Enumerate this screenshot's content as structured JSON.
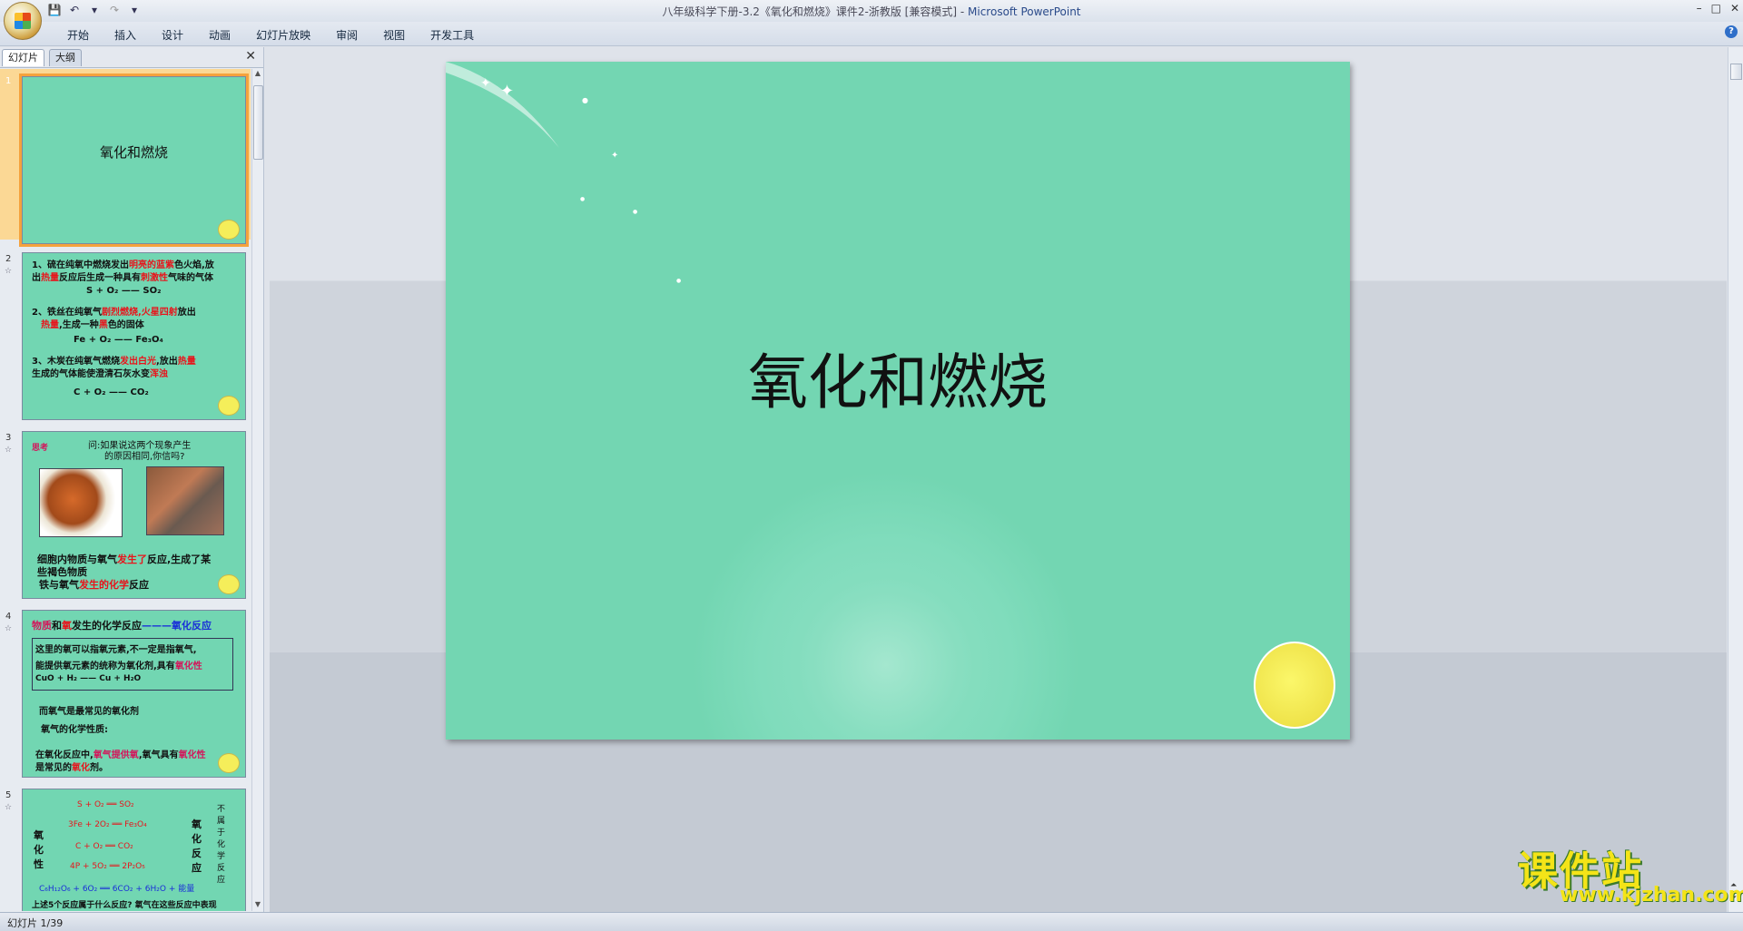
{
  "window": {
    "title_doc": "八年级科学下册-3.2《氧化和燃烧》课件2-浙教版 [兼容模式] - ",
    "title_app": "Microsoft PowerPoint",
    "min": "–",
    "max": "□",
    "close": "✕"
  },
  "ribbon": {
    "tabs": [
      "开始",
      "插入",
      "设计",
      "动画",
      "幻灯片放映",
      "审阅",
      "视图",
      "开发工具"
    ],
    "help": "?"
  },
  "pane": {
    "tab_slides": "幻灯片",
    "tab_outline": "大纲",
    "close": "✕"
  },
  "thumbs": {
    "s1": {
      "num": "1",
      "title": "氧化和燃烧"
    },
    "s2": {
      "num": "2",
      "l1": "1、硫在纯氧中燃烧发出",
      "l1r": "明亮的蓝紫",
      "l1b": "色火焰,放",
      "l2": "出",
      "l2r": "热量",
      "l2b": "反应后生成一种具有",
      "l2r2": "刺激性",
      "l2c": "气味的气体",
      "l3": "S  +  O₂   ——  SO₂",
      "l4": "2、铁丝在纯氧气",
      "l4r": "剧烈燃烧,火星四射",
      "l4b": "放出",
      "l5r": "热量",
      "l5": ",生成一种",
      "l5r2": "黑",
      "l5b": "色的固体",
      "l6": "Fe  +  O₂   ——  Fe₃O₄",
      "l7": "3、木炭在纯氧气燃烧",
      "l7r": "发出白光",
      "l7b": ",放出",
      "l7r2": "热量",
      "l8": "生成的气体能使澄清石灰水变",
      "l8r": "浑浊",
      "l9": "C  +  O₂   ——  CO₂"
    },
    "s3": {
      "num": "3",
      "tag": "思考",
      "q1": "问:如果说这两个现象产生",
      "q2": "的原因相同,你信吗?",
      "l1": "细胞内物质与氧气",
      "l1r": "发生了",
      "l1b": "反应,生成了某",
      "l2": "些褐色物质",
      "l3": "铁与氧气",
      "l3r": "发生的化学",
      "l3b": "反应"
    },
    "s4": {
      "num": "4",
      "h1": "物质",
      "h2": "和",
      "h3": "氧",
      "h4": "发生的化学反应",
      "h5": "———氧化反应",
      "b1": "这里的氧可以指氧元素,不一定是指氧气,",
      "b2": "能提供氧元素的统称为氧化剂,具有",
      "b2m": "氧化性",
      "b3": "CuO  +  H₂      ——      Cu  +  H₂O",
      "l1": "而氧气是最常见的氧化剂",
      "l2": "氧气的化学性质:",
      "l3": "在氧化反应中,",
      "l3m": "氧气提供氧",
      "l3b": ",氧气具有",
      "l3m2": "氧化性",
      "l4": "是常见的",
      "l4r": "氧化",
      "l4b": "剂。"
    },
    "s5": {
      "num": "5",
      "e1": "S  +  O₂  ══  SO₂",
      "e2": "3Fe  +  2O₂  ══  Fe₃O₄",
      "e3": "C  +  O₂  ══  CO₂",
      "e4": "4P  +  5O₂  ══  2P₂O₅",
      "e5": "C₆H₁₂O₆  +  6O₂  ══  6CO₂  +  6H₂O  +  能量",
      "side1": "氧化性",
      "side2": "氧化反应",
      "side3": "不属于化学反应",
      "foot": "上述5个反应属于什么反应? 氧气在这些反应中表现"
    }
  },
  "slide": {
    "title": "氧化和燃烧"
  },
  "status": {
    "text": "幻灯片 1/39"
  },
  "watermark": {
    "top": "课件站",
    "url": "www.kjzhan.com"
  }
}
